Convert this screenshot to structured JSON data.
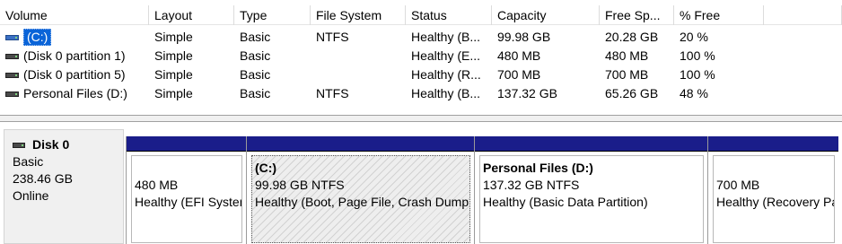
{
  "columns": [
    "Volume",
    "Layout",
    "Type",
    "File System",
    "Status",
    "Capacity",
    "Free Sp...",
    "% Free"
  ],
  "volumes": [
    {
      "name": "(C:)",
      "layout": "Simple",
      "type": "Basic",
      "fs": "NTFS",
      "status": "Healthy (B...",
      "capacity": "99.98 GB",
      "free": "20.28 GB",
      "pct": "20 %",
      "icon": "system-volume-icon",
      "selected": true
    },
    {
      "name": "(Disk 0 partition 1)",
      "layout": "Simple",
      "type": "Basic",
      "fs": "",
      "status": "Healthy (E...",
      "capacity": "480 MB",
      "free": "480 MB",
      "pct": "100 %",
      "icon": "volume-icon"
    },
    {
      "name": "(Disk 0 partition 5)",
      "layout": "Simple",
      "type": "Basic",
      "fs": "",
      "status": "Healthy (R...",
      "capacity": "700 MB",
      "free": "700 MB",
      "pct": "100 %",
      "icon": "volume-icon"
    },
    {
      "name": "Personal Files (D:)",
      "layout": "Simple",
      "type": "Basic",
      "fs": "NTFS",
      "status": "Healthy (B...",
      "capacity": "137.32 GB",
      "free": "65.26 GB",
      "pct": "48 %",
      "icon": "volume-icon"
    }
  ],
  "disk": {
    "name": "Disk 0",
    "type": "Basic",
    "size": "238.46 GB",
    "state": "Online",
    "icon": "disk-icon"
  },
  "partitions": [
    {
      "title": "",
      "size": "480 MB",
      "status": "Healthy (EFI System Partition)"
    },
    {
      "title": "(C:)",
      "size": "99.98 GB NTFS",
      "status": "Healthy (Boot, Page File, Crash Dump, Primary Partition)"
    },
    {
      "title": "Personal Files  (D:)",
      "size": "137.32 GB NTFS",
      "status": "Healthy (Basic Data Partition)"
    },
    {
      "title": "",
      "size": "700 MB",
      "status": "Healthy (Recovery Partition)"
    }
  ],
  "colors": {
    "partition_header": "#1a1d8a",
    "selection": "#0a64d8"
  }
}
